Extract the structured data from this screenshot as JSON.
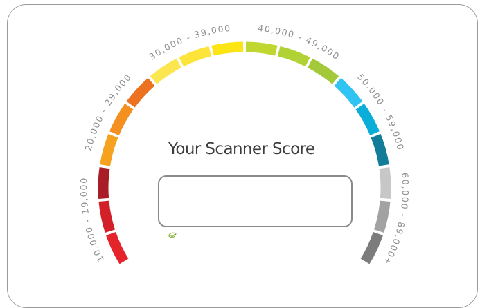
{
  "title": "Your Scanner Score",
  "score_value": "",
  "gauge": {
    "bands": [
      {
        "label": "10,000 - 19,000",
        "colors": [
          "#e4232b",
          "#d21f28",
          "#a81d26"
        ]
      },
      {
        "label": "20,000 - 29,000",
        "colors": [
          "#f6a21e",
          "#f3901f",
          "#ec7221"
        ]
      },
      {
        "label": "30,000 - 39,000",
        "colors": [
          "#fbe64f",
          "#fce43a",
          "#fde415"
        ]
      },
      {
        "label": "40,000 - 49,000",
        "colors": [
          "#bfd730",
          "#b1d234",
          "#a3c93a"
        ]
      },
      {
        "label": "50,000 - 59,000",
        "colors": [
          "#31c4f3",
          "#0aaed9",
          "#127c99"
        ]
      },
      {
        "label": "60,000 - 89,000+",
        "colors": [
          "#c7c7c7",
          "#a2a2a2",
          "#7c7c7c"
        ]
      }
    ]
  },
  "icons": {
    "leaf": "leaf-icon"
  },
  "colors": {
    "border": "#9a9a9a",
    "title": "#3d3d3d",
    "label": "#8f8f8f",
    "leaf": "#8db43f"
  }
}
